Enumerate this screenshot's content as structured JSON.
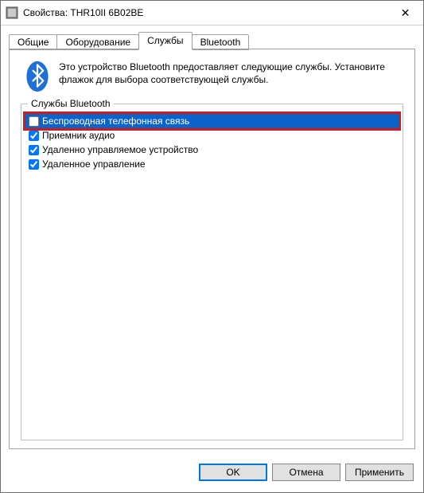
{
  "window": {
    "title": "Свойства: THR10II 6B02BE",
    "close_glyph": "✕"
  },
  "tabs": [
    {
      "id": "general",
      "label": "Общие"
    },
    {
      "id": "hardware",
      "label": "Оборудование"
    },
    {
      "id": "services",
      "label": "Службы"
    },
    {
      "id": "bluetooth",
      "label": "Bluetooth"
    }
  ],
  "intro_text": "Это устройство Bluetooth предоставляет следующие службы. Установите флажок для выбора соответствующей службы.",
  "group_label": "Службы Bluetooth",
  "services": [
    {
      "label": "Беспроводная телефонная связь",
      "checked": false,
      "selected": true,
      "highlighted": true
    },
    {
      "label": "Приемник аудио",
      "checked": true,
      "selected": false,
      "highlighted": false
    },
    {
      "label": "Удаленно управляемое устройство",
      "checked": true,
      "selected": false,
      "highlighted": false
    },
    {
      "label": "Удаленное управление",
      "checked": true,
      "selected": false,
      "highlighted": false
    }
  ],
  "buttons": {
    "ok": "OK",
    "cancel": "Отмена",
    "apply": "Применить"
  }
}
